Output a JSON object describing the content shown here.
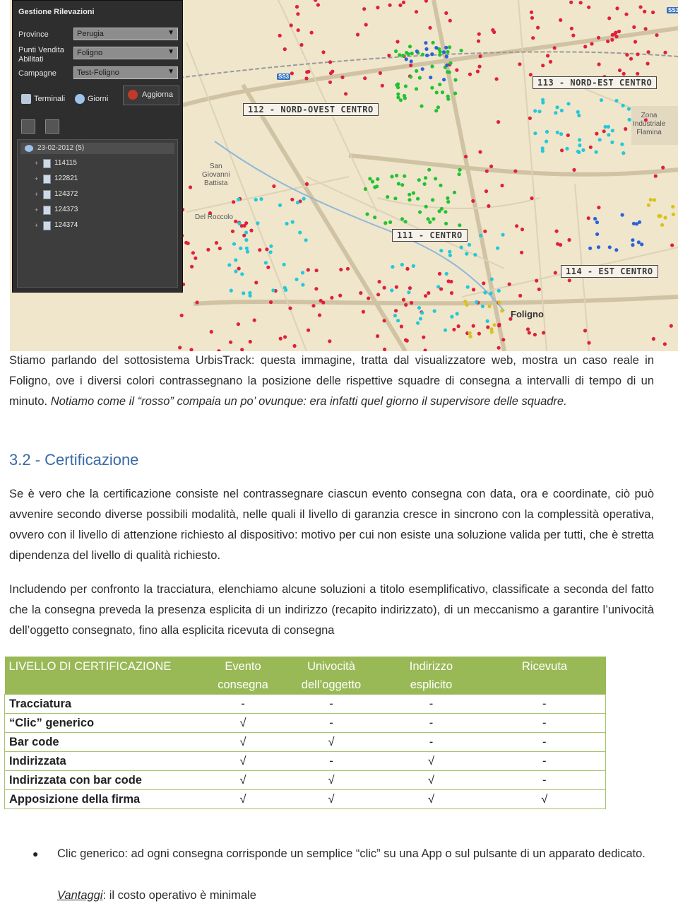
{
  "panel": {
    "title": "Gestione Rilevazioni",
    "fields": [
      {
        "label": "Province",
        "value": "Perugia"
      },
      {
        "label": "Punti Vendita\nAbilitati",
        "value": "Foligno"
      },
      {
        "label": "Campagne",
        "value": "Test-Foligno"
      }
    ],
    "tabs": [
      "Terminali",
      "Giorni"
    ],
    "refresh_label": "Aggiorna",
    "tree_date": "23-02-2012 (5)",
    "tree_items": [
      "114115",
      "122821",
      "124372",
      "124373",
      "124374"
    ]
  },
  "map": {
    "zones": [
      "112 - NORD-OVEST CENTRO",
      "113 - NORD-EST CENTRO",
      "111 - CENTRO",
      "114 - EST CENTRO"
    ],
    "town": "Foligno",
    "areas": [
      {
        "text": "Zona\nIndustriale\nFlamina"
      },
      {
        "text": "San\nGiovanni\nBattista"
      },
      {
        "text": "Del Roccolo"
      }
    ],
    "road_badges": [
      "SS3",
      "SS3"
    ]
  },
  "intro": {
    "part1": "Stiamo parlando del sottosistema UrbisTrack: questa immagine, tratta dal visualizzatore web, mostra un caso reale in Foligno, ove i diversi colori contrassegnano la posizione delle rispettive squadre di consegna a intervalli di tempo di un minuto. ",
    "part2": "Notiamo come il “rosso” compaia un po’ ovunque: era infatti quel giorno il supervisore delle squadre."
  },
  "heading": "3.2 - Certificazione",
  "paragraph1": "Se è vero che la certificazione consiste nel contrassegnare ciascun evento consegna con data, ora e coordinate, ciò può avvenire secondo diverse possibili modalità, nelle quali il livello di garanzia cresce in sincrono con la complessità operativa, ovvero con il livello di attenzione richiesto al dispositivo: motivo per cui non esiste una soluzione valida per tutti, che è stretta dipendenza del livello di qualità richiesto.",
  "paragraph2": "Includendo per confronto la tracciatura, elenchiamo alcune soluzioni a titolo esemplificativo, classificate a seconda del fatto che la consegna preveda la presenza esplicita di un indirizzo (recapito indirizzato), di un meccanismo a garantire l’univocità dell’oggetto consegnato, fino alla esplicita ricevuta di consegna",
  "table": {
    "headers": [
      "LIVELLO DI CERTIFICAZIONE",
      "Evento consegna",
      "Univocità dell’oggetto",
      "Indirizzo esplicito",
      "Ricevuta"
    ],
    "rows": [
      {
        "label": "Tracciatura",
        "cells": [
          "-",
          "-",
          "-",
          "-"
        ]
      },
      {
        "label": "“Clic” generico",
        "cells": [
          "√",
          "-",
          "-",
          "-"
        ]
      },
      {
        "label": "Bar code",
        "cells": [
          "√",
          "√",
          "-",
          "-"
        ]
      },
      {
        "label": "Indirizzata",
        "cells": [
          "√",
          "-",
          "√",
          "-"
        ]
      },
      {
        "label": "Indirizzata con bar code",
        "cells": [
          "√",
          "√",
          "√",
          "-"
        ]
      },
      {
        "label": "Apposizione della firma",
        "cells": [
          "√",
          "√",
          "√",
          "√"
        ]
      }
    ]
  },
  "bullet": {
    "text": "Clic generico: ad ogni consegna corrisponde un semplice “clic” su una App o sul pulsante di un apparato dedicato.",
    "vantaggi_label": "Vantaggi",
    "vantaggi_text": ": il costo operativo è minimale"
  },
  "colors": {
    "heading": "#3a6aa4",
    "table_header": "#99b956",
    "dot_red": "#e0203a",
    "dot_green": "#22c230",
    "dot_cyan": "#23c9d8",
    "dot_blue": "#2b62d8",
    "dot_yellow": "#d9c21a"
  }
}
